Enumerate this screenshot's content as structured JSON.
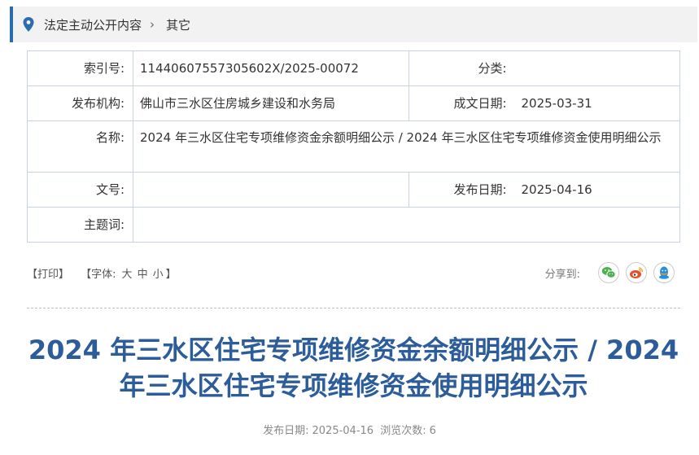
{
  "breadcrumb": {
    "parent": "法定主动公开内容",
    "current": "其它"
  },
  "meta": {
    "index_label": "索引号:",
    "index_value": "11440607557305602X/2025-00072",
    "category_label": "分类:",
    "category_value": "",
    "publisher_label": "发布机构:",
    "publisher_value": "佛山市三水区住房城乡建设和水务局",
    "created_label": "成文日期:",
    "created_value": "2025-03-31",
    "name_label": "名称:",
    "name_value": "2024 年三水区住宅专项维修资金余额明细公示 / 2024 年三水区住宅专项维修资金使用明细公示",
    "docno_label": "文号:",
    "docno_value": "",
    "pubdate_label": "发布日期:",
    "pubdate_value": "2025-04-16",
    "keywords_label": "主题词:",
    "keywords_value": ""
  },
  "tools": {
    "print": "【打印】",
    "font_prefix": "【字体:",
    "large": "大",
    "medium": "中",
    "small": "小",
    "font_suffix": "】"
  },
  "share": {
    "label": "分享到:"
  },
  "article": {
    "title": "2024 年三水区住宅专项维修资金余额明细公示 / 2024 年三水区住宅专项维修资金使用明细公示",
    "pub_label": "发布日期:",
    "pub_date": "2025-04-16",
    "views_label": "浏览次数:",
    "views": "6"
  },
  "colors": {
    "accent": "#2c6bb0",
    "title": "#2c5d9a",
    "wechat": "#4caf50",
    "weibo": "#e6512c",
    "qq": "#2a8fd6"
  }
}
